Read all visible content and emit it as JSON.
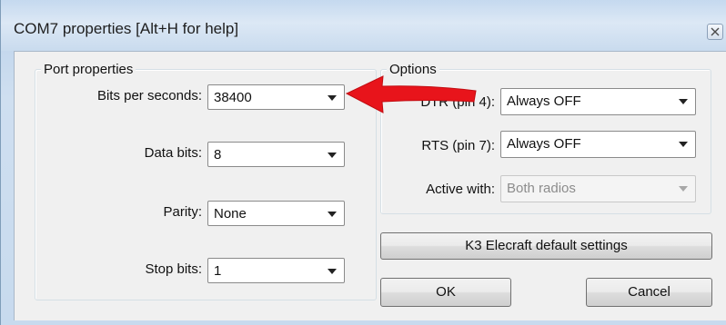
{
  "window": {
    "title": "COM7 properties [Alt+H for help]",
    "close_icon": "close-icon"
  },
  "port_properties": {
    "title": "Port properties",
    "bits_per_second": {
      "label": "Bits per seconds:",
      "value": "38400"
    },
    "data_bits": {
      "label": "Data bits:",
      "value": "8"
    },
    "parity": {
      "label": "Parity:",
      "value": "None"
    },
    "stop_bits": {
      "label": "Stop bits:",
      "value": "1"
    }
  },
  "options": {
    "title": "Options",
    "dtr": {
      "label": "DTR (pin 4):",
      "value": "Always OFF"
    },
    "rts": {
      "label": "RTS (pin 7):",
      "value": "Always OFF"
    },
    "active_with": {
      "label": "Active with:",
      "value": "Both radios",
      "enabled": false
    }
  },
  "buttons": {
    "defaults": "K3 Elecraft default settings",
    "ok": "OK",
    "cancel": "Cancel"
  },
  "annotation": {
    "arrow_color": "#e8141b",
    "arrow_icon": "red-arrow-icon"
  }
}
